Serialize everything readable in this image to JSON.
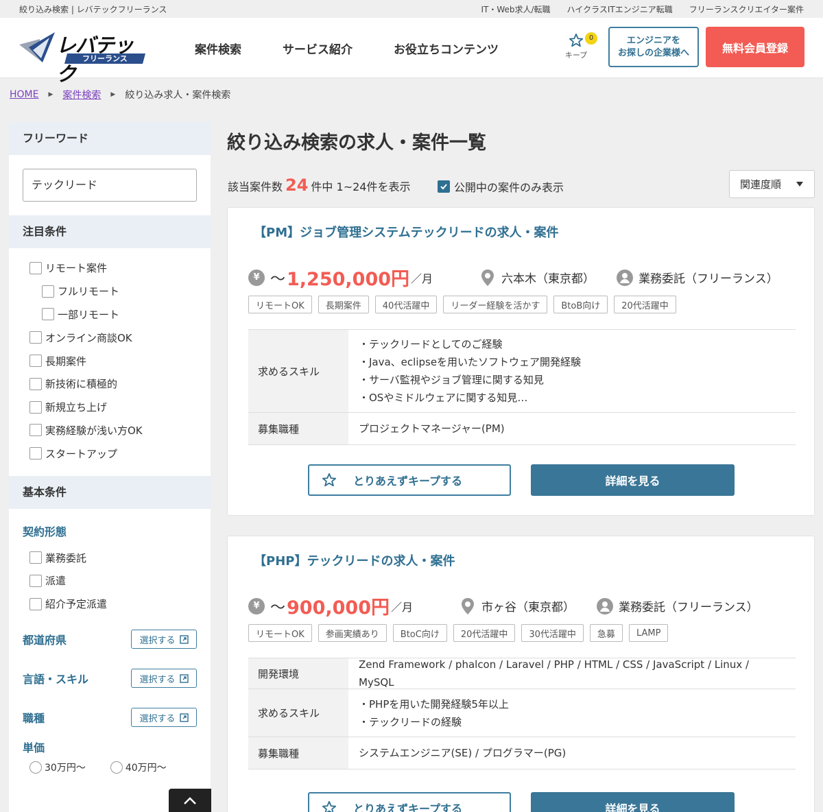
{
  "utility": {
    "site_label": "絞り込み検索 | レバテックフリーランス",
    "links": [
      "IT・Web求人/転職",
      "ハイクラスITエンジニア転職",
      "フリーランスクリエイター案件"
    ]
  },
  "header": {
    "logo_text": "レバテック",
    "logo_sub": "フリーランス",
    "nav": [
      "案件検索",
      "サービス紹介",
      "お役立ちコンテンツ"
    ],
    "keep_label": "キープ",
    "keep_count": "0",
    "corp_button": [
      "エンジニアを",
      "お探しの企業様へ"
    ],
    "register_button": "無料会員登録"
  },
  "breadcrumb": [
    "HOME",
    "案件検索",
    "絞り込み求人・案件検索"
  ],
  "sidebar": {
    "freeword_title": "フリーワード",
    "freeword_value": "テックリード",
    "featured_title": "注目条件",
    "featured": [
      {
        "label": "リモート案件",
        "indent": false
      },
      {
        "label": "フルリモート",
        "indent": true
      },
      {
        "label": "一部リモート",
        "indent": true
      },
      {
        "label": "オンライン商談OK",
        "indent": false
      },
      {
        "label": "長期案件",
        "indent": false
      },
      {
        "label": "新技術に積極的",
        "indent": false
      },
      {
        "label": "新規立ち上げ",
        "indent": false
      },
      {
        "label": "実務経験が浅い方OK",
        "indent": false
      },
      {
        "label": "スタートアップ",
        "indent": false
      }
    ],
    "basic_title": "基本条件",
    "contract_title": "契約形態",
    "contract": [
      "業務委託",
      "派遣",
      "紹介予定派遣"
    ],
    "select_rows": [
      {
        "label": "都道府県",
        "button": "選択する"
      },
      {
        "label": "言語・スキル",
        "button": "選択する"
      },
      {
        "label": "職種",
        "button": "選択する"
      }
    ],
    "price_title": "単価",
    "price_options": [
      "30万円〜",
      "40万円〜"
    ]
  },
  "main": {
    "title": "絞り込み検索の求人・案件一覧",
    "count_prefix": "該当案件数",
    "count": "24",
    "count_suffix": "件中 1~24件を表示",
    "public_only": "公開中の案件のみ表示",
    "sort": "関連度順",
    "keep_button": "とりあえずキープする",
    "detail_button": "詳細を見る",
    "jobs": [
      {
        "title": "【PM】ジョブ管理システムテックリードの求人・案件",
        "price": "1,250,000円",
        "per": "／月",
        "location": "六本木（東京都）",
        "contract": "業務委託（フリーランス）",
        "tags": [
          "リモートOK",
          "長期案件",
          "40代活躍中",
          "リーダー経験を活かす",
          "BtoB向け",
          "20代活躍中"
        ],
        "skills_label": "求めるスキル",
        "skills": [
          "・テックリードとしてのご経験",
          "・Java、eclipseを用いたソフトウェア開発経験",
          "・サーバ監視やジョブ管理に関する知見",
          "・OSやミドルウェアに関する知見…"
        ],
        "role_label": "募集職種",
        "role": "プロジェクトマネージャー(PM)"
      },
      {
        "title": "【PHP】テックリードの求人・案件",
        "price": "900,000円",
        "per": "／月",
        "location": "市ヶ谷（東京都）",
        "contract": "業務委託（フリーランス）",
        "tags": [
          "リモートOK",
          "参画実績あり",
          "BtoC向け",
          "20代活躍中",
          "30代活躍中",
          "急募",
          "LAMP"
        ],
        "env_label": "開発環境",
        "env": "Zend Framework / phalcon / Laravel / PHP / HTML / CSS / JavaScript / Linux / MySQL",
        "skills_label": "求めるスキル",
        "skills": [
          "・PHPを用いた開発経験5年以上",
          "・テックリードの経験"
        ],
        "role_label": "募集職種",
        "role": "システムエンジニア(SE) / プログラマー(PG)"
      }
    ]
  }
}
